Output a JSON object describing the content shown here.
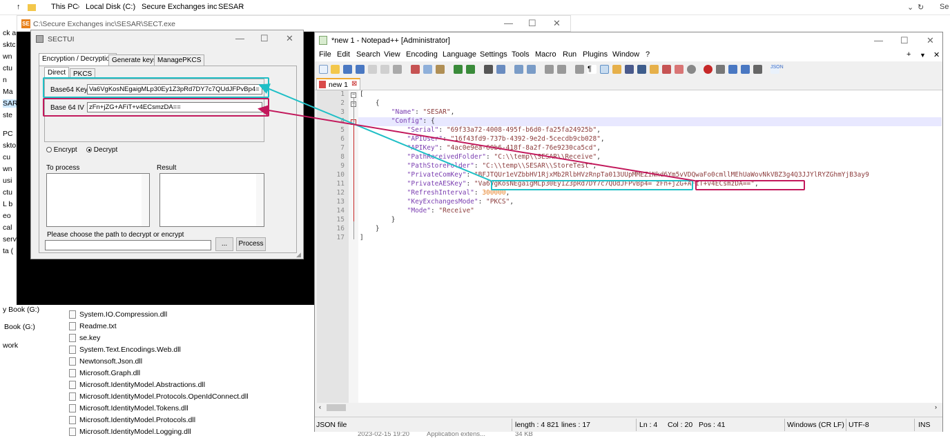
{
  "explorer": {
    "breadcrumb": [
      "This PC",
      "Local Disk (C:)",
      "Secure Exchanges inc",
      "SESAR"
    ],
    "nav_items": [
      "ck a",
      "sktc",
      "wn",
      "ctu",
      "n",
      "Ma",
      "SAR",
      "ste",
      "PC",
      "skto",
      "cu",
      "wn",
      "usi",
      "ctu",
      "L b",
      "eo",
      "cal",
      "serv",
      "ta (",
      "y Book (G:)",
      "Book (G:)",
      "work"
    ],
    "files": [
      "System.IO.Compression.dll",
      "Readme.txt",
      "se.key",
      "System.Text.Encodings.Web.dll",
      "Newtonsoft.Json.dll",
      "Microsoft.Graph.dll",
      "Microsoft.IdentityModel.Abstractions.dll",
      "Microsoft.IdentityModel.Protocols.OpenIdConnect.dll",
      "Microsoft.IdentityModel.Tokens.dll",
      "Microsoft.IdentityModel.Protocols.dll",
      "Microsoft.IdentityModel.Logging.dll"
    ],
    "footer_date": "2023-02-15 19:20",
    "footer_type": "Application extens...",
    "footer_size": "34 KB",
    "search_stub": "Se"
  },
  "sect_window": {
    "title": "C:\\Secure Exchanges inc\\SESAR\\SECT.exe",
    "logo": "SE"
  },
  "sectui": {
    "title": "SECTUI",
    "tabs": [
      "Encryption / Decryption",
      "Generate keys",
      "ManagePKCS"
    ],
    "subtabs": [
      "Direct",
      "PKCS"
    ],
    "key_label": "Base64 Key",
    "key_value": "Va6VgKosNEgaigMLp30Ey1Z3pRd7DY7c7QUdJFPvBp4=",
    "iv_label": "Base 64 IV",
    "iv_value": "zFn+jZG+AFiT+v4ECsmzDA==",
    "radio_encrypt": "Encrypt",
    "radio_decrypt": "Decrypt",
    "to_process_label": "To process",
    "result_label": "Result",
    "path_label": "Please choose the path to decrypt or encrypt",
    "browse_button": "...",
    "process_button": "Process"
  },
  "npp": {
    "title": "*new 1 - Notepad++ [Administrator]",
    "menu": [
      "File",
      "Edit",
      "Search",
      "View",
      "Encoding",
      "Language",
      "Settings",
      "Tools",
      "Macro",
      "Run",
      "Plugins",
      "Window",
      "?"
    ],
    "tab": "new 1",
    "lines": [
      {
        "n": "1",
        "text": "["
      },
      {
        "n": "2",
        "text": "    {"
      },
      {
        "n": "3",
        "key": "\"Name\"",
        "val": "\"SESAR\"",
        "tail": ","
      },
      {
        "n": "4",
        "key": "\"Config\"",
        "val": "{",
        "tail": ""
      },
      {
        "n": "5",
        "key": "\"Serial\"",
        "val": "\"69f33a72-4008-495f-b6d0-fa25fa24925b\"",
        "tail": ","
      },
      {
        "n": "6",
        "key": "\"APIUser\"",
        "val": "\"16f43fd9-737b-4392-9e2d-5cecdb9cb028\"",
        "tail": ","
      },
      {
        "n": "7",
        "key": "\"APIKey\"",
        "val": "\"4ac0e9ea-60b6-418f-8a2f-76e9230ca5cd\"",
        "tail": ","
      },
      {
        "n": "8",
        "key": "\"PathReceivedFolder\"",
        "val": "\"C:\\\\temp\\\\SESAR\\\\Receive\"",
        "tail": ","
      },
      {
        "n": "9",
        "key": "\"PathStoreFolder\"",
        "val": "\"C:\\\\temp\\\\SESAR\\\\StoreTest\"",
        "tail": ","
      },
      {
        "n": "10",
        "key": "\"PrivateComKey\"",
        "val": "\"BFJTQUr1eVZbbHV1RjxMb2RlbHVzRnpTa013UUpMMEZiNkd6Ym5vVDQwaFo0cmllMEhUaWovNkVBZ3g4Q3JJYlRYZGhmYjB3ay9",
        "tail": ""
      },
      {
        "n": "11",
        "key": "\"PrivateAESKey\"",
        "val": "\"Va6VgKosNEgaigMLp30Ey1Z3pRd7DY7c7QUdJFPvBp4= zFn+jZG+AFiT+v4ECsmzDA==\"",
        "tail": ","
      },
      {
        "n": "12",
        "key": "\"RefreshInterval\"",
        "val": "300000",
        "tail": ","
      },
      {
        "n": "13",
        "key": "\"KeyExchangesMode\"",
        "val": "\"PKCS\"",
        "tail": ","
      },
      {
        "n": "14",
        "key": "\"Mode\"",
        "val": "\"Receive\"",
        "tail": ""
      },
      {
        "n": "15",
        "text": "        }"
      },
      {
        "n": "16",
        "text": "    }"
      },
      {
        "n": "17",
        "text": "]"
      }
    ],
    "status": {
      "type": "JSON file",
      "length": "length : 4 821",
      "lines": "lines : 17",
      "ln": "Ln : 4",
      "col": "Col : 20",
      "pos": "Pos : 41",
      "eol": "Windows (CR LF)",
      "enc": "UTF-8",
      "ins": "INS"
    }
  },
  "colors": {
    "annotation_cyan": "#1fbfc6",
    "annotation_magenta": "#c2185b",
    "json_key": "#7a3db0",
    "json_string": "#8c3c3c",
    "json_number": "#e67e22"
  }
}
